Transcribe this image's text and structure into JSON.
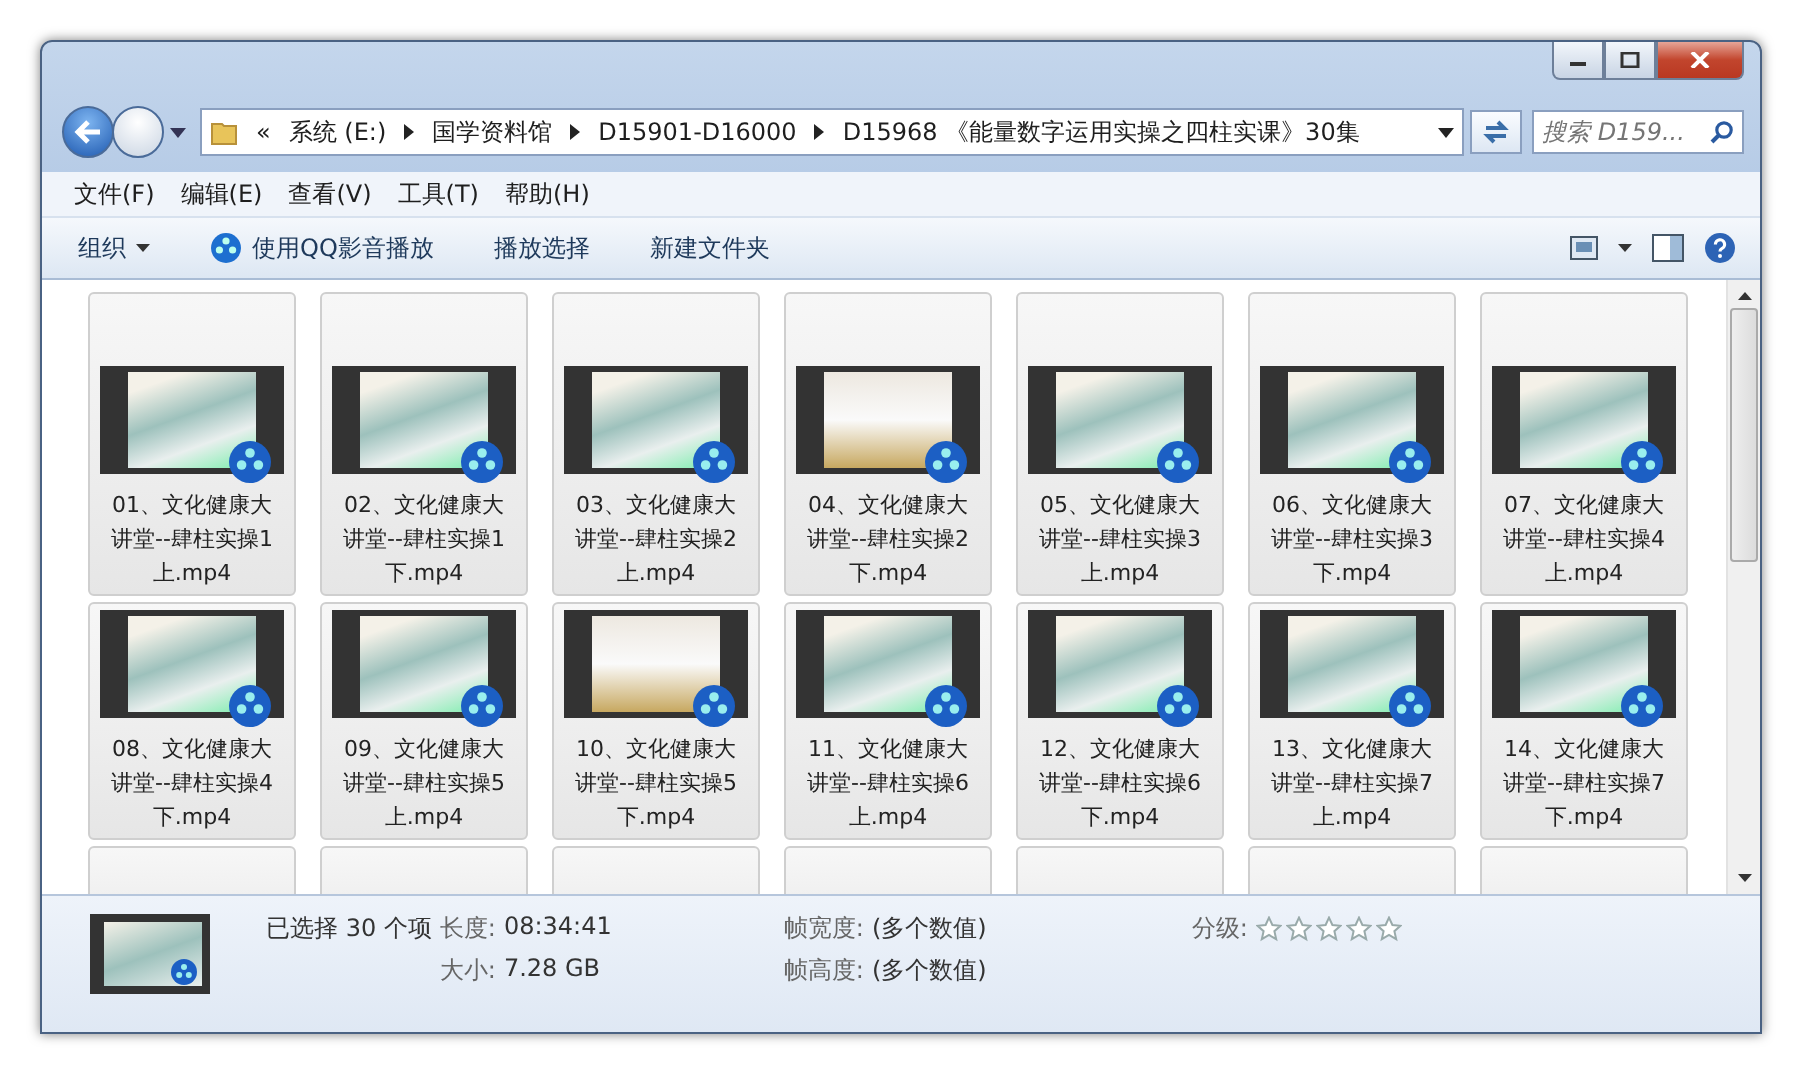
{
  "window": {
    "buttons": [
      {
        "kind": "minimize"
      },
      {
        "kind": "maximize"
      },
      {
        "kind": "close"
      }
    ]
  },
  "address": {
    "overflow": "«",
    "crumbs": [
      "系统 (E:)",
      "国学资料馆",
      "D15901-D16000",
      "D15968 《能量数字运用实操之四柱实课》30集"
    ]
  },
  "search": {
    "placeholder": "搜索 D159..."
  },
  "menu": [
    "文件(F)",
    "编辑(E)",
    "查看(V)",
    "工具(T)",
    "帮助(H)"
  ],
  "toolbar": [
    {
      "kind": "dropdown",
      "label": "组织"
    },
    {
      "kind": "play",
      "label": "使用QQ影音播放"
    },
    {
      "kind": "plain",
      "label": "播放选择"
    },
    {
      "kind": "plain",
      "label": "新建文件夹"
    }
  ],
  "files": [
    {
      "name": "01、文化健康大讲堂--肆柱实操1上.mp4",
      "kind": "landscape",
      "selected": true
    },
    {
      "name": "02、文化健康大讲堂--肆柱实操1下.mp4",
      "kind": "landscape",
      "selected": true
    },
    {
      "name": "03、文化健康大讲堂--肆柱实操2上.mp4",
      "kind": "landscape",
      "selected": true
    },
    {
      "name": "04、文化健康大讲堂--肆柱实操2下.mp4",
      "kind": "classroom",
      "selected": true
    },
    {
      "name": "05、文化健康大讲堂--肆柱实操3上.mp4",
      "kind": "landscape",
      "selected": true
    },
    {
      "name": "06、文化健康大讲堂--肆柱实操3下.mp4",
      "kind": "landscape",
      "selected": true
    },
    {
      "name": "07、文化健康大讲堂--肆柱实操4上.mp4",
      "kind": "landscape",
      "selected": true
    },
    {
      "name": "08、文化健康大讲堂--肆柱实操4下.mp4",
      "kind": "landscape",
      "selected": true
    },
    {
      "name": "09、文化健康大讲堂--肆柱实操5上.mp4",
      "kind": "landscape",
      "selected": true
    },
    {
      "name": "10、文化健康大讲堂--肆柱实操5下.mp4",
      "kind": "classroom",
      "selected": true
    },
    {
      "name": "11、文化健康大讲堂--肆柱实操6上.mp4",
      "kind": "landscape",
      "selected": true
    },
    {
      "name": "12、文化健康大讲堂--肆柱实操6下.mp4",
      "kind": "landscape",
      "selected": true
    },
    {
      "name": "13、文化健康大讲堂--肆柱实操7上.mp4",
      "kind": "landscape",
      "selected": true
    },
    {
      "name": "14、文化健康大讲堂--肆柱实操7下.mp4",
      "kind": "landscape",
      "selected": true
    }
  ],
  "files_cut_off": [
    {
      "selected": true
    },
    {
      "selected": true
    },
    {
      "selected": true
    },
    {
      "selected": true
    },
    {
      "selected": true
    },
    {
      "selected": true
    },
    {
      "selected": true
    }
  ],
  "details": {
    "selection": "已选择 30 个项",
    "fields": [
      {
        "label": "长度:",
        "value": "08:34:41"
      },
      {
        "label": "大小:",
        "value": "7.28 GB"
      }
    ],
    "fields_2": [
      {
        "label": "帧宽度:",
        "value": "(多个数值)"
      },
      {
        "label": "帧高度:",
        "value": "(多个数值)"
      }
    ],
    "rating": {
      "label": "分级:",
      "stars": 0
    }
  }
}
